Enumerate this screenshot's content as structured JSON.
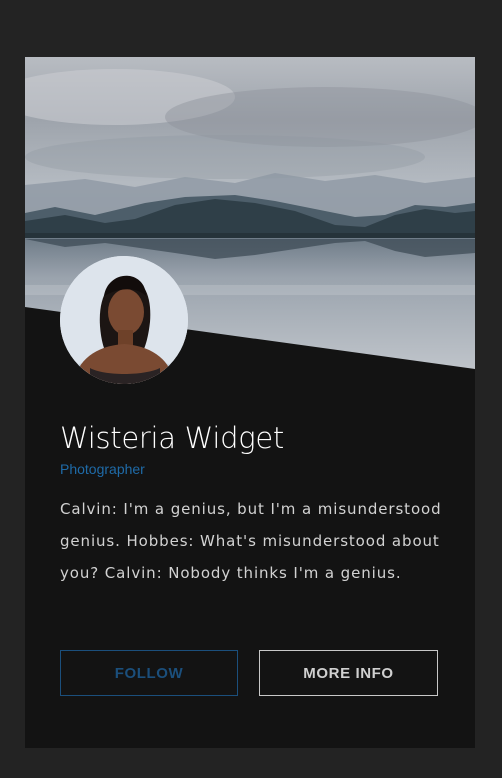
{
  "profile": {
    "name": "Wisteria Widget",
    "role": "Photographer",
    "bio": "Calvin: I'm a genius, but I'm a misunderstood genius. Hobbes: What's misunderstood about you? Calvin: Nobody thinks I'm a genius."
  },
  "actions": {
    "follow_label": "FOLLOW",
    "more_info_label": "MORE INFO"
  },
  "images": {
    "cover": "lake-mountains-cover-photo",
    "avatar": "profile-avatar-photo"
  },
  "colors": {
    "page_background": "#232323",
    "card_background": "#131313",
    "accent": "#1f6ba8",
    "follow_border": "#1b4f7c",
    "text": "#ffffff"
  }
}
